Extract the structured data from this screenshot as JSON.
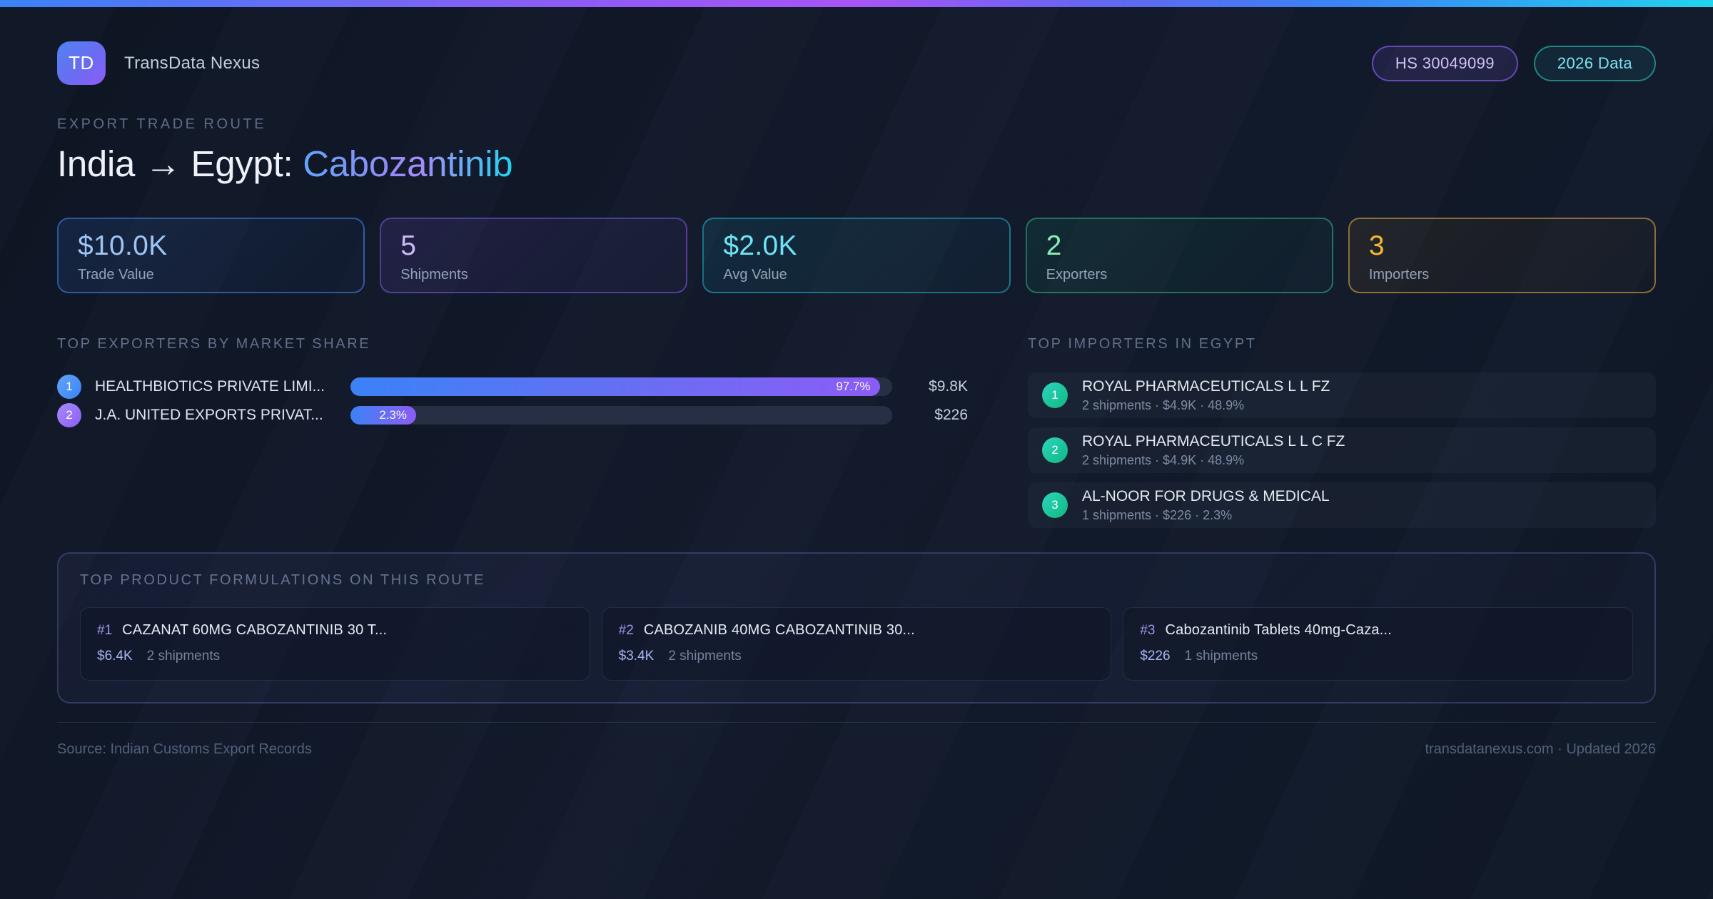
{
  "colors": {
    "background": "#0f1726",
    "accent_blue": "#3b82f6",
    "accent_purple": "#8b5cf6",
    "accent_cyan": "#22d3ee",
    "accent_green": "#34d399",
    "accent_amber": "#f5b82e",
    "accent_teal_badge": "#10b981"
  },
  "brand": {
    "logo_text": "TD",
    "name": "TransData Nexus"
  },
  "badges": [
    {
      "label": "HS 30049099"
    },
    {
      "label": "2026 Data"
    }
  ],
  "header": {
    "eyebrow": "EXPORT TRADE ROUTE",
    "title_prefix": "India → Egypt: ",
    "title_highlight": "Cabozantinib"
  },
  "stats": [
    {
      "value": "$10.0K",
      "label": "Trade Value"
    },
    {
      "value": "5",
      "label": "Shipments"
    },
    {
      "value": "$2.0K",
      "label": "Avg Value"
    },
    {
      "value": "2",
      "label": "Exporters"
    },
    {
      "value": "3",
      "label": "Importers"
    }
  ],
  "exporters": {
    "heading": "TOP EXPORTERS BY MARKET SHARE",
    "items": [
      {
        "rank": "1",
        "name": "HEALTHBIOTICS PRIVATE LIMI...",
        "share_pct": 97.7,
        "share_label": "97.7%",
        "value": "$9.8K"
      },
      {
        "rank": "2",
        "name": "J.A. UNITED EXPORTS PRIVAT...",
        "share_pct": 2.3,
        "share_label": "2.3%",
        "value": "$226"
      }
    ]
  },
  "importers": {
    "heading": "TOP IMPORTERS IN EGYPT",
    "items": [
      {
        "rank": "1",
        "name": "ROYAL PHARMACEUTICALS L L FZ",
        "meta": "2 shipments · $4.9K · 48.9%"
      },
      {
        "rank": "2",
        "name": "ROYAL PHARMACEUTICALS L L C FZ",
        "meta": "2 shipments · $4.9K · 48.9%"
      },
      {
        "rank": "3",
        "name": "AL-NOOR FOR DRUGS & MEDICAL",
        "meta": "1 shipments · $226 · 2.3%"
      }
    ]
  },
  "products": {
    "heading": "TOP PRODUCT FORMULATIONS ON THIS ROUTE",
    "items": [
      {
        "rank": "#1",
        "name": "CAZANAT 60MG CABOZANTINIB 30 T...",
        "value": "$6.4K",
        "shipments": "2 shipments"
      },
      {
        "rank": "#2",
        "name": "CABOZANIB 40MG CABOZANTINIB 30...",
        "value": "$3.4K",
        "shipments": "2 shipments"
      },
      {
        "rank": "#3",
        "name": "Cabozantinib Tablets 40mg-Caza...",
        "value": "$226",
        "shipments": "1 shipments"
      }
    ]
  },
  "footer": {
    "source": "Source: Indian Customs Export Records",
    "site": "transdatanexus.com · Updated 2026"
  }
}
